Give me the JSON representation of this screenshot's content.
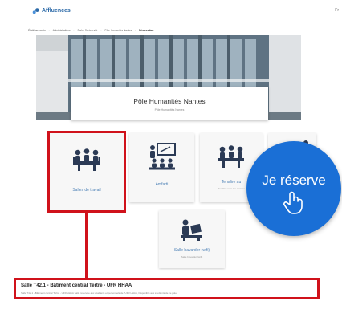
{
  "app": {
    "name": "Affluences"
  },
  "topbar": {
    "right_text": "Fr"
  },
  "breadcrumb": [
    "Établissements",
    "Administrations",
    "Sorbe l'Université",
    "Pôle Humanités Nantes",
    "Réservation"
  ],
  "hero": {
    "title": "Pôle Humanités Nantes",
    "subtitle": "Pôle Humanités Nantes"
  },
  "tiles": [
    {
      "label": "Salles de travail",
      "sub": "",
      "icon": "meeting-table-icon",
      "highlighted": true
    },
    {
      "label": "Amfarti",
      "sub": "",
      "icon": "presentation-icon",
      "highlighted": false
    },
    {
      "label": "Tenalire au",
      "sub": "Tenalire entre les classes",
      "icon": "group-workspace-icon",
      "highlighted": false
    },
    {
      "label": "",
      "sub": "",
      "icon": "computer-desk-icon",
      "highlighted": false
    },
    {
      "label": "Salle bavarder (wifi)",
      "sub": "Salle bavarder (wifi)",
      "icon": "person-computer-icon",
      "highlighted": false
    }
  ],
  "cta": {
    "label": "Je réserve",
    "icon": "pointing-hand-icon"
  },
  "selection": {
    "title": "Salle T42.1 - Bâtiment central Tertre - UFR HHAA",
    "description": "Salle T42.1 - Bâtiment central Tertre - UFR HHAA Salle réservée aux étudiants et personnels de l'UFR HHAA, Disponible aux étudiants de ce pole"
  },
  "colors": {
    "accent": "#1a6fd6",
    "highlight": "#d0121b",
    "link": "#4a7fb5",
    "icon": "#2b3a55"
  }
}
